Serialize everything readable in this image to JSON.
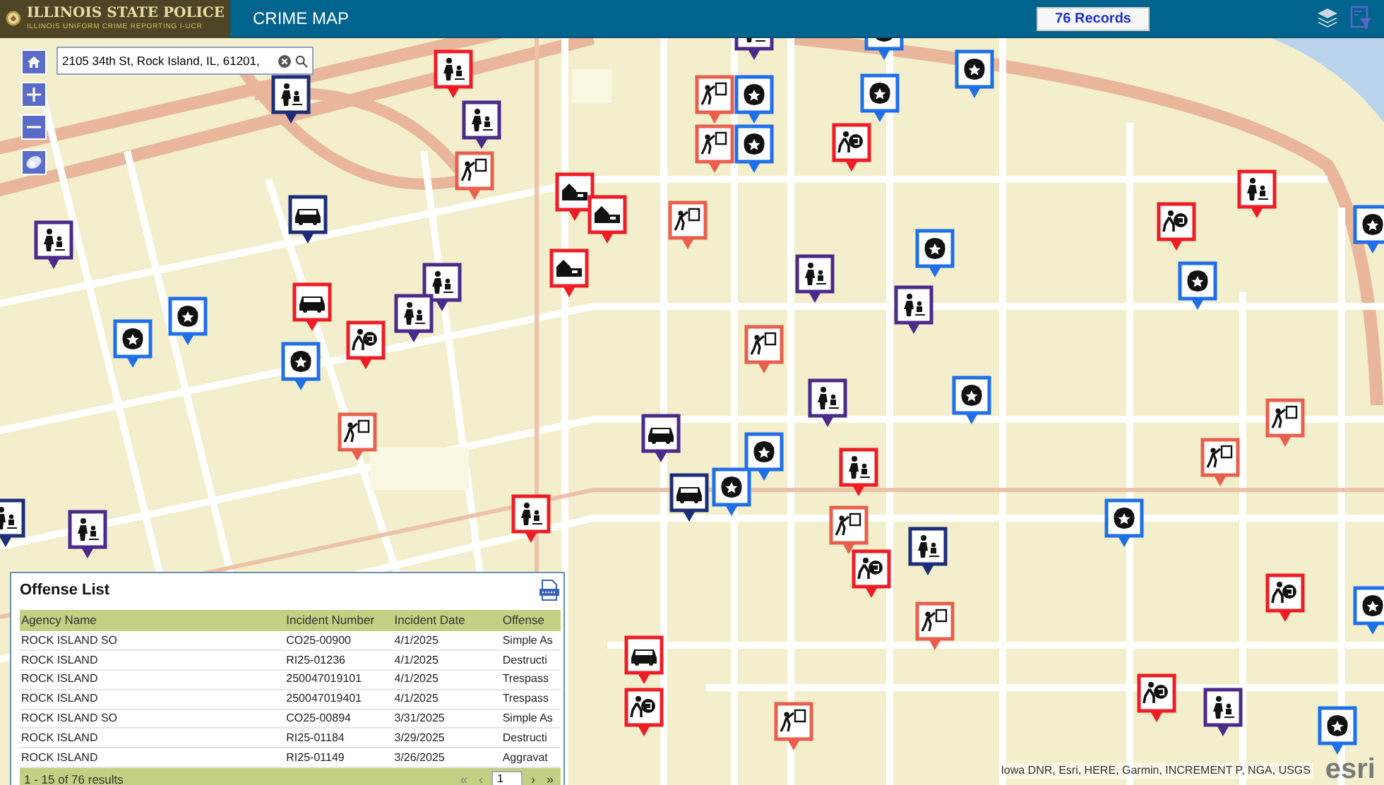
{
  "header": {
    "logo_title": "ILLINOIS STATE POLICE",
    "logo_subtitle": "ILLINOIS UNIFORM CRIME REPORTING   I-UCR",
    "title": "CRIME MAP",
    "records_button": "76 Records"
  },
  "search": {
    "value": "2105 34th St, Rock Island, IL, 61201,"
  },
  "map_pins": [
    {
      "kind": "person",
      "color": "#ee1c25"
    },
    {
      "kind": "person",
      "color": "#4a2a8a"
    },
    {
      "kind": "badge",
      "color": "#1f6fe8"
    },
    {
      "kind": "badge",
      "color": "#1f6fe8"
    },
    {
      "kind": "vandal",
      "color": "#e8604c"
    },
    {
      "kind": "badge",
      "color": "#1f6fe8"
    },
    {
      "kind": "badge",
      "color": "#1f6fe8"
    },
    {
      "kind": "person",
      "color": "#1c2e78"
    },
    {
      "kind": "person",
      "color": "#4a2a8a"
    },
    {
      "kind": "vandal",
      "color": "#e8604c"
    },
    {
      "kind": "badge",
      "color": "#1f6fe8"
    },
    {
      "kind": "thief",
      "color": "#ee1c25"
    },
    {
      "kind": "vandal",
      "color": "#e8604c"
    },
    {
      "kind": "house",
      "color": "#ee1c25"
    },
    {
      "kind": "house",
      "color": "#ee1c25"
    },
    {
      "kind": "person",
      "color": "#ee1c25"
    },
    {
      "kind": "vandal",
      "color": "#e8604c"
    },
    {
      "kind": "vehicle",
      "color": "#1c2e78"
    },
    {
      "kind": "person",
      "color": "#4a2a8a"
    },
    {
      "kind": "thief",
      "color": "#ee1c25"
    },
    {
      "kind": "badge",
      "color": "#1f6fe8"
    },
    {
      "kind": "house",
      "color": "#ee1c25"
    },
    {
      "kind": "person",
      "color": "#4a2a8a"
    },
    {
      "kind": "person",
      "color": "#4a2a8a"
    },
    {
      "kind": "badge",
      "color": "#1f6fe8"
    },
    {
      "kind": "person",
      "color": "#4a2a8a"
    },
    {
      "kind": "person",
      "color": "#4a2a8a"
    },
    {
      "kind": "badge",
      "color": "#1f6fe8"
    },
    {
      "kind": "badge",
      "color": "#1f6fe8"
    },
    {
      "kind": "badge",
      "color": "#1f6fe8"
    },
    {
      "kind": "vehicle",
      "color": "#ee1c25"
    },
    {
      "kind": "thief",
      "color": "#ee1c25"
    },
    {
      "kind": "badge",
      "color": "#1f6fe8"
    },
    {
      "kind": "vandal",
      "color": "#e8604c"
    },
    {
      "kind": "person",
      "color": "#4a2a8a"
    },
    {
      "kind": "badge",
      "color": "#1f6fe8"
    },
    {
      "kind": "vandal",
      "color": "#e8604c"
    },
    {
      "kind": "vandal",
      "color": "#e8604c"
    },
    {
      "kind": "vehicle",
      "color": "#4a2a8a"
    },
    {
      "kind": "badge",
      "color": "#1f6fe8"
    },
    {
      "kind": "person",
      "color": "#ee1c25"
    },
    {
      "kind": "vandal",
      "color": "#e8604c"
    },
    {
      "kind": "vehicle",
      "color": "#1c2e78"
    },
    {
      "kind": "badge",
      "color": "#1f6fe8"
    },
    {
      "kind": "person",
      "color": "#ee1c25"
    },
    {
      "kind": "person",
      "color": "#1c2e78"
    },
    {
      "kind": "vandal",
      "color": "#e8604c"
    },
    {
      "kind": "person",
      "color": "#1c2e78"
    },
    {
      "kind": "badge",
      "color": "#1f6fe8"
    },
    {
      "kind": "person",
      "color": "#4a2a8a"
    },
    {
      "kind": "thief",
      "color": "#ee1c25"
    },
    {
      "kind": "thief",
      "color": "#ee1c25"
    },
    {
      "kind": "vandal",
      "color": "#e8604c"
    },
    {
      "kind": "badge",
      "color": "#1f6fe8"
    },
    {
      "kind": "vehicle",
      "color": "#ee1c25"
    },
    {
      "kind": "thief",
      "color": "#ee1c25"
    },
    {
      "kind": "vandal",
      "color": "#e8604c"
    },
    {
      "kind": "thief",
      "color": "#ee1c25"
    },
    {
      "kind": "person",
      "color": "#4a2a8a"
    },
    {
      "kind": "badge",
      "color": "#1f6fe8"
    }
  ],
  "offense_list": {
    "title": "Offense List",
    "columns": [
      "Agency Name",
      "Incident Number",
      "Incident Date",
      "Offense"
    ],
    "rows": [
      [
        "ROCK ISLAND SO",
        "CO25-00900",
        "4/1/2025",
        "Simple As"
      ],
      [
        "ROCK ISLAND",
        "RI25-01236",
        "4/1/2025",
        "Destructi"
      ],
      [
        "ROCK ISLAND",
        "250047019101",
        "4/1/2025",
        "Trespass"
      ],
      [
        "ROCK ISLAND",
        "250047019401",
        "4/1/2025",
        "Trespass"
      ],
      [
        "ROCK ISLAND SO",
        "CO25-00894",
        "3/31/2025",
        "Simple As"
      ],
      [
        "ROCK ISLAND",
        "RI25-01184",
        "3/29/2025",
        "Destructi"
      ],
      [
        "ROCK ISLAND",
        "RI25-01149",
        "3/26/2025",
        "Aggravat"
      ]
    ],
    "summary": "1 - 15 of 76 results",
    "pager": {
      "back": [
        {
          "label": "«",
          "disabled": true
        },
        {
          "label": "‹",
          "disabled": true
        }
      ],
      "page": "1",
      "forward": [
        {
          "label": "›",
          "disabled": false
        },
        {
          "label": "»",
          "disabled": false
        }
      ]
    }
  },
  "attribution": "Iowa DNR, Esri, HERE, Garmin, INCREMENT P, NGA, USGS",
  "esri_logo": "esri"
}
